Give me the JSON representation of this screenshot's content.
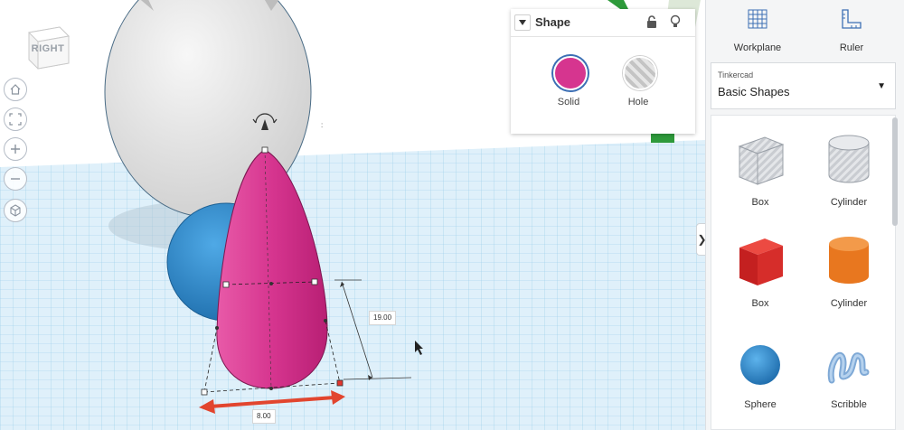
{
  "viewcube": {
    "face_label": "RIGHT"
  },
  "view_controls": [
    "home-view-icon",
    "fit-all-icon",
    "zoom-in-icon",
    "zoom-out-icon",
    "ortho-view-icon"
  ],
  "dimensions": {
    "height": "19.00",
    "width": "8.00"
  },
  "shape_panel": {
    "title": "Shape",
    "solid_label": "Solid",
    "hole_label": "Hole",
    "solid_color": "#d6358f"
  },
  "sidebar": {
    "workplane_label": "Workplane",
    "ruler_label": "Ruler",
    "library_brand": "Tinkercad",
    "library_value": "Basic Shapes",
    "shapes": [
      {
        "label": "Box",
        "color": "#b9bcc2"
      },
      {
        "label": "Cylinder",
        "color": "#b9bcc2"
      },
      {
        "label": "Box",
        "color": "#d42a2a"
      },
      {
        "label": "Cylinder",
        "color": "#e8771f"
      },
      {
        "label": "Sphere",
        "color": "#2f8fd4"
      },
      {
        "label": "Scribble",
        "color": "#7fa9d6"
      }
    ]
  }
}
